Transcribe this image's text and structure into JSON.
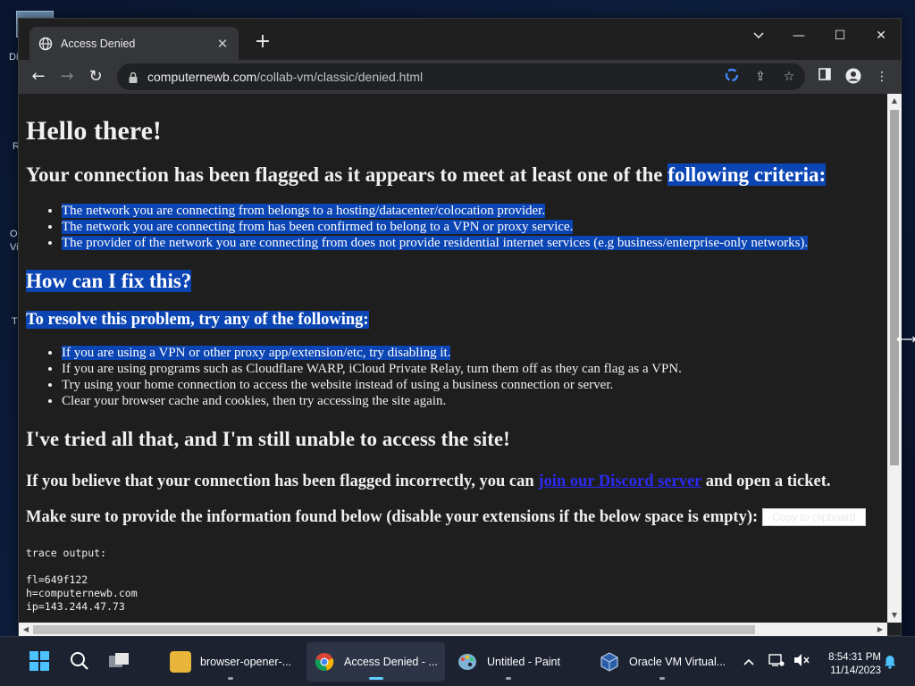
{
  "browser": {
    "tab_title": "Access Denied",
    "url_host": "computernewb.com",
    "url_path": "/collab-vm/classic/denied.html"
  },
  "desktop": {
    "left_labels": [
      "Di",
      "R",
      "O",
      "Vi",
      "T"
    ]
  },
  "page": {
    "heading_hello": "Hello there!",
    "criteria_heading_plain": "Your connection has been flagged as it appears to meet at least one of the ",
    "criteria_heading_selected": "following criteria: ",
    "criteria": [
      "The network you are connecting from belongs to a hosting/datacenter/colocation provider.",
      "The network you are connecting from has been confirmed to belong to a VPN or proxy service.",
      "The provider of the network you are connecting from does not provide residential internet services (e.g business/enterprise-only networks)."
    ],
    "fix_heading": "How can I fix this? ",
    "resolve_heading": "To resolve this problem, try any of the following: ",
    "fixes": [
      "If you are using a VPN or other proxy app/extension/etc, try disabling it.",
      "If you are using programs such as Cloudflare WARP, iCloud Private Relay, turn them off as they can flag as a VPN.",
      "Try using your home connection to access the website instead of using a business connection or server.",
      "Clear your browser cache and cookies, then try accessing the site again."
    ],
    "tried_heading": "I've tried all that, and I'm still unable to access the site!",
    "believe_prefix": "If you believe that your connection has been flagged incorrectly, you can ",
    "believe_link": "join our Discord server",
    "believe_suffix": " and open a ticket.",
    "provide_text": "Make sure to provide the information found below (disable your extensions if the below space is empty):",
    "copy_button": "Copy to clipboard",
    "trace_label": "trace output:",
    "trace_lines": [
      "fl=649f122",
      "h=computernewb.com",
      "ip=143.244.47.73"
    ]
  },
  "taskbar": {
    "items": [
      {
        "label": "browser-opener-..."
      },
      {
        "label": "Access Denied - ..."
      },
      {
        "label": "Untitled - Paint"
      },
      {
        "label": "Oracle VM Virtual..."
      }
    ],
    "time": "8:54:31 PM",
    "date": "11/14/2023"
  }
}
